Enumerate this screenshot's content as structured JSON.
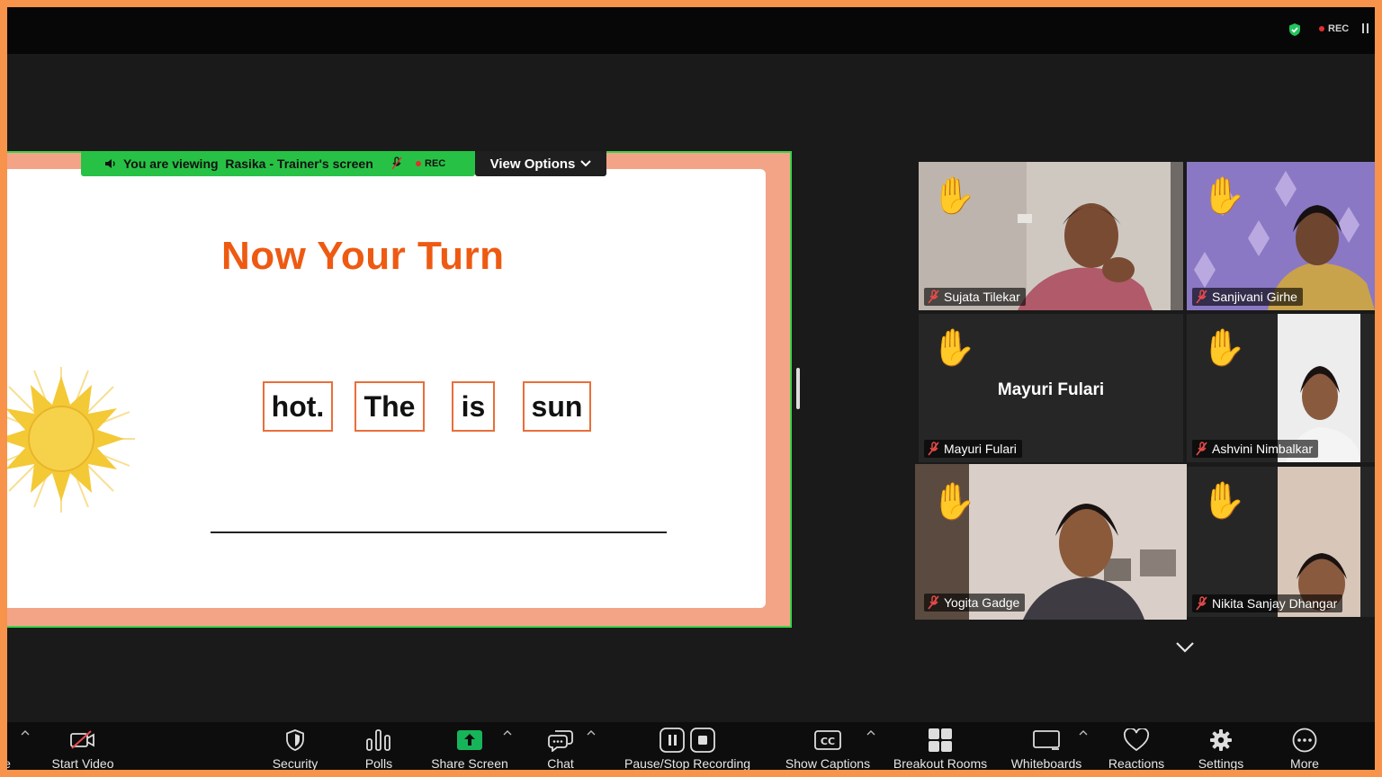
{
  "topbar": {
    "rec_label": "REC"
  },
  "share": {
    "viewing_prefix": "You are viewing",
    "presenter": "Rasika - Trainer's screen",
    "rec_label": "REC",
    "view_options_label": "View Options",
    "slide": {
      "title": "Now Your Turn",
      "words": [
        "hot.",
        "The",
        "is",
        "sun"
      ]
    }
  },
  "gallery": [
    {
      "name": "Sujata Tilekar",
      "hand_raised": true,
      "muted": true
    },
    {
      "name": "Sanjivani Girhe",
      "hand_raised": true,
      "muted": true
    },
    {
      "name": "Mayuri Fulari",
      "center_label": "Mayuri Fulari",
      "hand_raised": true,
      "muted": true
    },
    {
      "name": "Ashvini Nimbalkar",
      "hand_raised": true,
      "muted": true
    },
    {
      "name": "Yogita Gadge",
      "hand_raised": true,
      "muted": true,
      "active_speaker": true
    },
    {
      "name": "Nikita Sanjay Dhangar",
      "hand_raised": true,
      "muted": true
    }
  ],
  "hand_emoji": "✋",
  "toolbar": {
    "start_video": "Start Video",
    "security": "Security",
    "polls": "Polls",
    "share_screen": "Share Screen",
    "chat": "Chat",
    "recording": "Pause/Stop Recording",
    "captions": "Show Captions",
    "breakout": "Breakout Rooms",
    "whiteboards": "Whiteboards",
    "reactions": "Reactions",
    "settings": "Settings",
    "more": "More",
    "edge_char": "e"
  },
  "colors": {
    "accent_green": "#27c245",
    "title_orange": "#ee5a12",
    "frame_orange": "#f7934a",
    "rec_red": "#e0302d"
  }
}
